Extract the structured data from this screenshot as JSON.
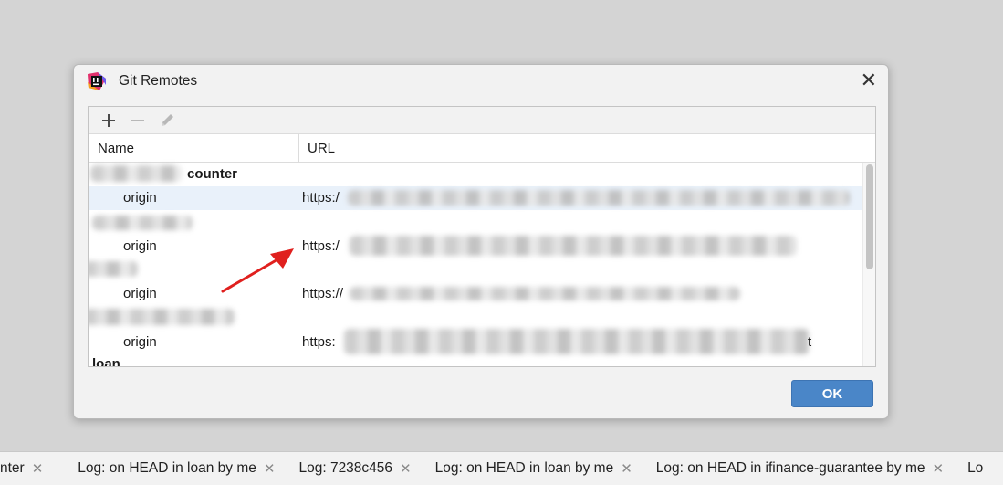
{
  "dialog": {
    "title": "Git Remotes",
    "ok_label": "OK"
  },
  "table": {
    "columns": [
      "Name",
      "URL"
    ],
    "rows": [
      {
        "type": "group",
        "name": "counter"
      },
      {
        "type": "remote",
        "name": "origin",
        "url": "https:/",
        "selected": true
      },
      {
        "type": "group",
        "name": ""
      },
      {
        "type": "remote",
        "name": "origin",
        "url": "https:/",
        "selected": false
      },
      {
        "type": "group",
        "name": ""
      },
      {
        "type": "remote",
        "name": "origin",
        "url": "https://",
        "selected": false
      },
      {
        "type": "group",
        "name": ""
      },
      {
        "type": "remote",
        "name": "origin",
        "url": "https:",
        "url_tail": "t",
        "selected": false
      },
      {
        "type": "group",
        "name": "loan"
      }
    ]
  },
  "bottom_tabs": [
    "nter",
    "Log: on HEAD in loan by me",
    "Log: 7238c456",
    "Log: on HEAD in loan by me",
    "Log: on HEAD in ifinance-guarantee by me",
    "Lo"
  ],
  "colors": {
    "accent": "#4a86c8",
    "selected_row": "#e9f1fa",
    "annotation_arrow": "#e0201e"
  }
}
